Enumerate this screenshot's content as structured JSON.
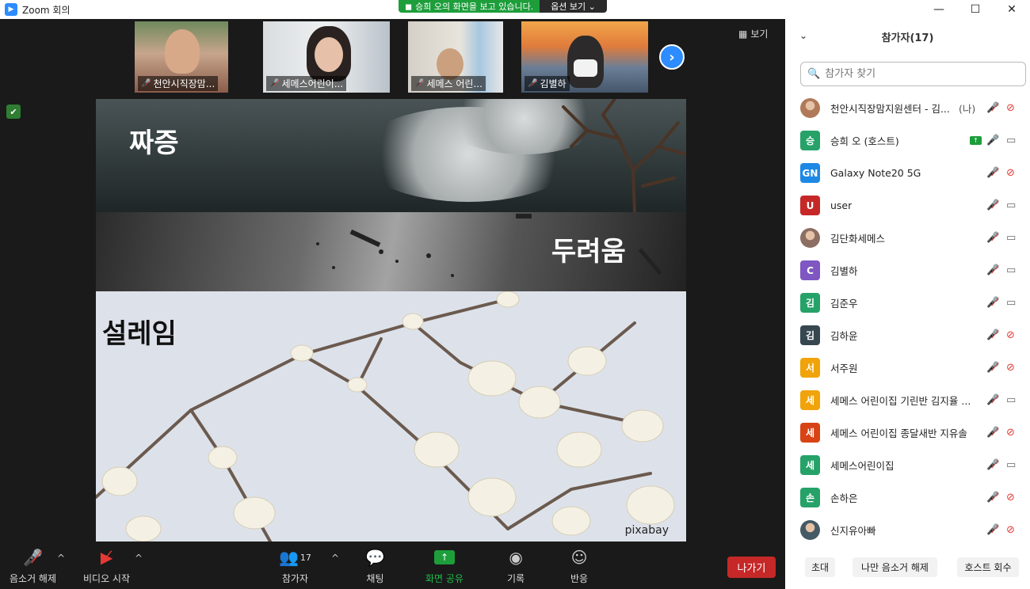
{
  "window": {
    "title": "Zoom 회의",
    "minimize": "—",
    "maximize": "☐",
    "close": "✕"
  },
  "share_banner": {
    "message": "승희 오의 화면을 보고 있습니다.",
    "options": "옵션 보기 ⌄"
  },
  "gallery": {
    "participants": [
      {
        "name": "천안시직장맘...",
        "muted": true
      },
      {
        "name": "세메스어린이...",
        "muted": true
      },
      {
        "name": "세메스 어린...",
        "muted": true
      },
      {
        "name": "김별하",
        "muted": true
      }
    ],
    "next_icon": "chevron-right-icon",
    "view_label": "보기"
  },
  "slide": {
    "word1": "짜증",
    "word2": "두려움",
    "word3": "설레임",
    "credit": "pixabay"
  },
  "toolbar": {
    "unmute": "음소거 해제",
    "start_video": "비디오 시작",
    "participants": "참가자",
    "participant_count": "17",
    "chat": "채팅",
    "share": "화면 공유",
    "record": "기록",
    "reactions": "반응",
    "leave": "나가기",
    "share_color": "#1d9e3b",
    "leave_color": "#c62828"
  },
  "panel": {
    "title": "참가자(17)",
    "search_placeholder": "참가자 찾기",
    "participants": [
      {
        "initial": "",
        "avatar_type": "photo",
        "name": "천안시직장맘지원센터 - 김...",
        "suffix": "(나)",
        "mic": "muted",
        "cam": "off",
        "color": "#b07a5a"
      },
      {
        "initial": "승",
        "name": "승희 오 (호스트)",
        "suffix": "",
        "mic": "on",
        "cam": "on",
        "share": true,
        "color": "#26a269"
      },
      {
        "initial": "GN",
        "name": "Galaxy Note20 5G",
        "suffix": "",
        "mic": "muted",
        "cam": "off",
        "color": "#1e88e5"
      },
      {
        "initial": "U",
        "name": "user",
        "suffix": "",
        "mic": "muted",
        "cam": "on",
        "color": "#c62828"
      },
      {
        "initial": "",
        "avatar_type": "photo",
        "name": "김단화세메스",
        "suffix": "",
        "mic": "muted",
        "cam": "on",
        "color": "#8d6e63"
      },
      {
        "initial": "C",
        "name": "김별하",
        "suffix": "",
        "mic": "muted",
        "cam": "on",
        "color": "#7e57c2"
      },
      {
        "initial": "김",
        "name": "김준우",
        "suffix": "",
        "mic": "muted",
        "cam": "on",
        "color": "#26a269"
      },
      {
        "initial": "김",
        "name": "김하윤",
        "suffix": "",
        "mic": "muted",
        "cam": "off",
        "color": "#37474f"
      },
      {
        "initial": "서",
        "name": "서주원",
        "suffix": "",
        "mic": "muted",
        "cam": "off",
        "color": "#f0a30a"
      },
      {
        "initial": "세",
        "name": "세메스 어린이집 기린반 김지율 ...",
        "suffix": "",
        "mic": "muted",
        "cam": "on",
        "color": "#f0a30a"
      },
      {
        "initial": "세",
        "name": "세메스 어린이집 종달새반 지유솔",
        "suffix": "",
        "mic": "muted",
        "cam": "off",
        "color": "#d84315"
      },
      {
        "initial": "세",
        "name": "세메스어린이집",
        "suffix": "",
        "mic": "muted",
        "cam": "on",
        "color": "#26a269"
      },
      {
        "initial": "손",
        "name": "손하은",
        "suffix": "",
        "mic": "muted",
        "cam": "off",
        "color": "#26a269"
      },
      {
        "initial": "",
        "avatar_type": "photo",
        "name": "신지유아빠",
        "suffix": "",
        "mic": "muted",
        "cam": "off",
        "color": "#455a64"
      }
    ],
    "footer": {
      "invite": "초대",
      "mute_me": "나만 음소거 해제",
      "reclaim_host": "호스트 회수"
    }
  }
}
